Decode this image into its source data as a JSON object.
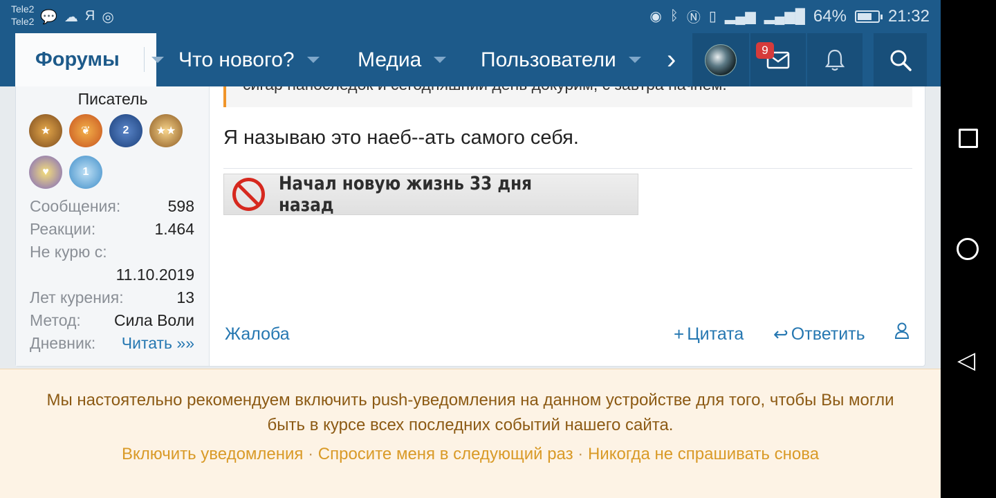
{
  "status_bar": {
    "carrier1": "Tele2",
    "carrier2": "Tele2",
    "battery_percent": "64%",
    "time": "21:32"
  },
  "navbar": {
    "active_tab": "Форумы",
    "items": [
      "Что нового?",
      "Медиа",
      "Пользователи"
    ],
    "inbox_badge": "9"
  },
  "post": {
    "user": {
      "title": "Писатель",
      "trophy_numbers": [
        "2",
        "1"
      ],
      "stats": [
        {
          "label": "Сообщения:",
          "value": "598"
        },
        {
          "label": "Реакции:",
          "value": "1.464"
        },
        {
          "label": "Не курю с:",
          "value": "11.10.2019"
        },
        {
          "label": "Лет курения:",
          "value": "13"
        },
        {
          "label": "Метод:",
          "value": "Сила Воли"
        },
        {
          "label": "Дневник:",
          "value": "Читать »»"
        }
      ]
    },
    "quote_tail": "сигар напоследок и сегодняшний день докурим, с завтра начнем.",
    "text": "Я называю это наеб--ать самого себя.",
    "signature": "Начал новую жизнь 33 дня назад",
    "actions": {
      "report": "Жалоба",
      "quote": "Цитата",
      "reply": "Ответить"
    }
  },
  "notice": {
    "message": "Мы настоятельно рекомендуем включить push-уведомления на данном устройстве для того, чтобы Вы могли быть в курсе всех последних событий нашего сайта.",
    "enable": "Включить уведомления",
    "later": "Спросите меня в следующий раз",
    "never": "Никогда не спрашивать снова"
  },
  "colors": {
    "header": "#1d5a8a",
    "link": "#2577b1",
    "notice_bg": "#fdf3e5",
    "notice_text": "#8c5a14",
    "notice_link": "#d99a27"
  }
}
